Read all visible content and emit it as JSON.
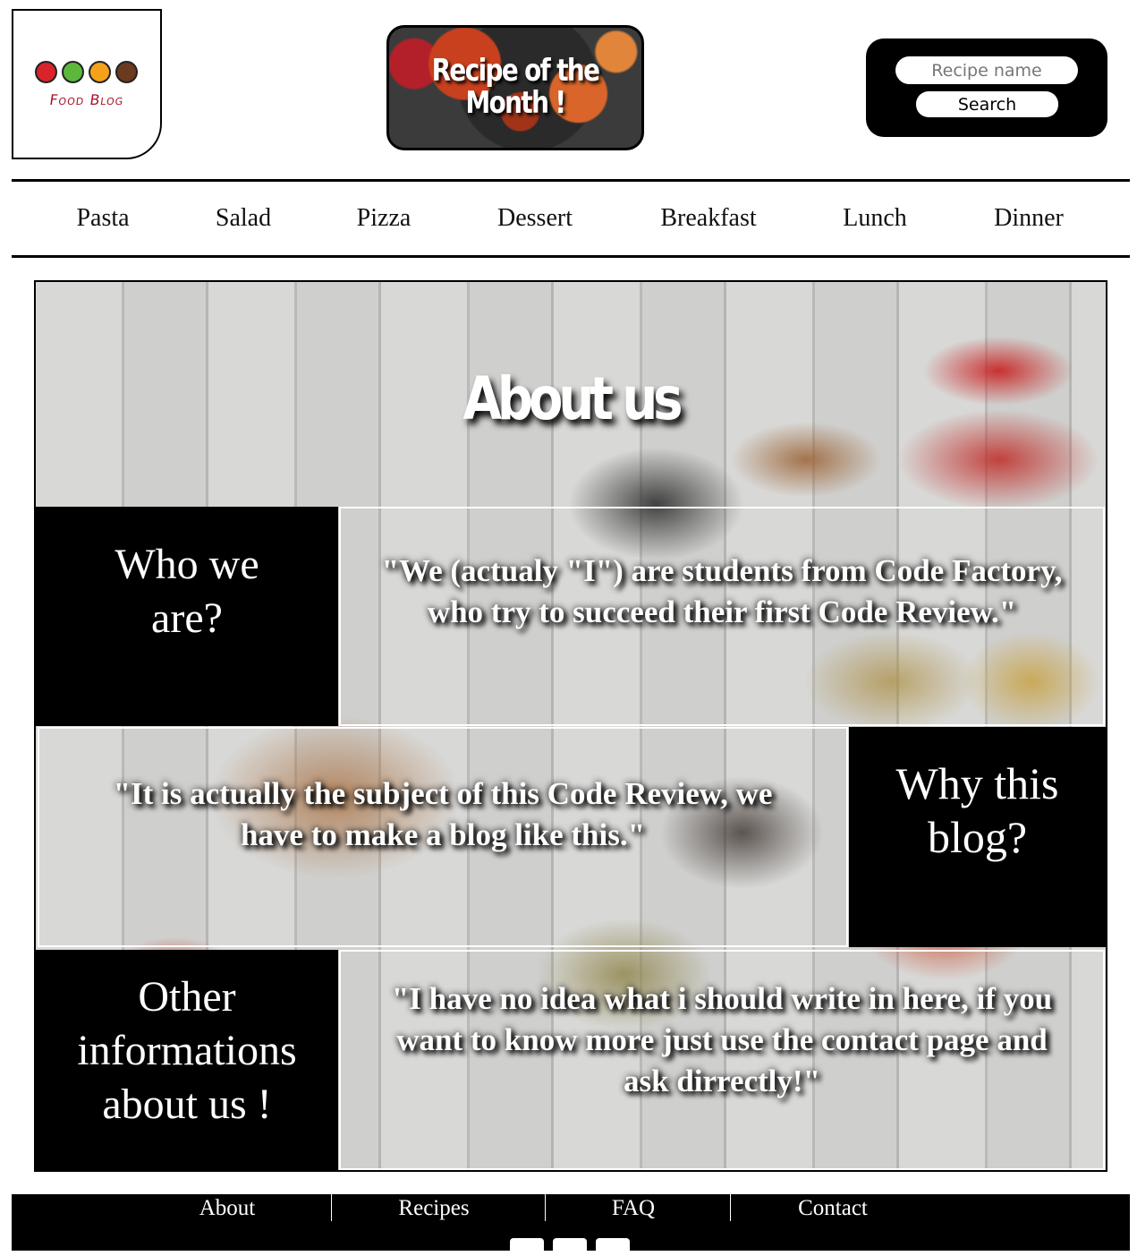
{
  "logo": {
    "brand": "Food Blog"
  },
  "featured": {
    "title": "Recipe of the Month !"
  },
  "search": {
    "placeholder": "Recipe name",
    "button_label": "Search"
  },
  "nav": {
    "items": [
      "Pasta",
      "Salad",
      "Pizza",
      "Dessert",
      "Breakfast",
      "Lunch",
      "Dinner"
    ]
  },
  "about": {
    "title": "About us",
    "sections": [
      {
        "heading": "Who we are?",
        "text": "\"We (actualy \"I\") are students from Code Factory, who try to succeed their first Code Review.\""
      },
      {
        "heading": "Why this blog?",
        "text": "\"It is actually the subject of this Code Review, we have to make a blog like this.\""
      },
      {
        "heading": "Other informations about us !",
        "text": "\"I have no idea what i should write in here, if you want to know more just use the contact page and ask dirrectly!\""
      }
    ]
  },
  "footer": {
    "links": [
      "About",
      "Recipes",
      "FAQ",
      "Contact"
    ],
    "social_icons": [
      "facebook-icon",
      "twitter-icon",
      "instagram-icon"
    ]
  }
}
